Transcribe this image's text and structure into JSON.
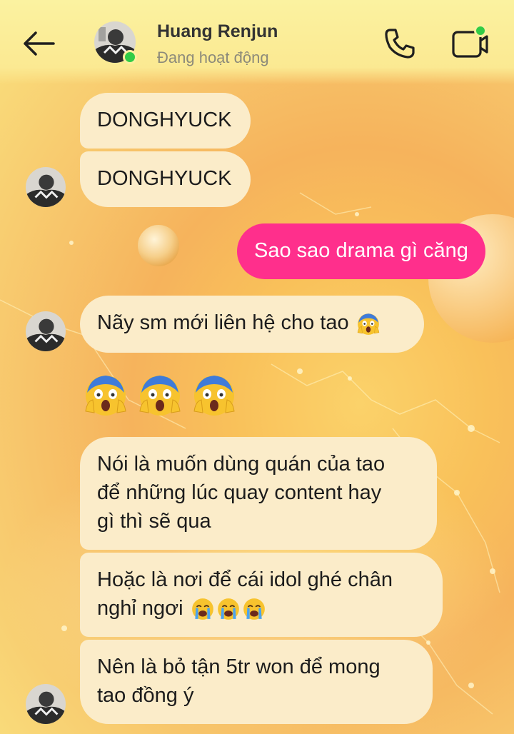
{
  "header": {
    "contact_name": "Huang Renjun",
    "contact_status": "Đang hoạt động"
  },
  "messages": {
    "m1": "DONGHYUCK",
    "m2": "DONGHYUCK",
    "m3_outgoing": "Sao sao drama gì căng",
    "m4": "Nãy sm mới liên hệ cho tao",
    "m6_line1": "Nói là muốn dùng quán của tao",
    "m6_line2": "để những lúc quay content hay",
    "m6_line3": "gì thì sẽ qua",
    "m7_line1": "Hoặc là nơi để cái idol ghé chân",
    "m7_line2": "nghỉ ngơi",
    "m8_line1": "Nên là bỏ tận 5tr won để mong",
    "m8_line2": "tao đồng ý"
  },
  "colors": {
    "incoming_bubble": "#fbecc9",
    "outgoing_bubble": "#ff2f8c",
    "online": "#31cc46",
    "icon_dark": "#1f1f1f"
  },
  "icons": [
    "back-arrow-icon",
    "phone-icon",
    "video-call-icon",
    "screaming-face-emoji",
    "crying-face-emoji"
  ]
}
